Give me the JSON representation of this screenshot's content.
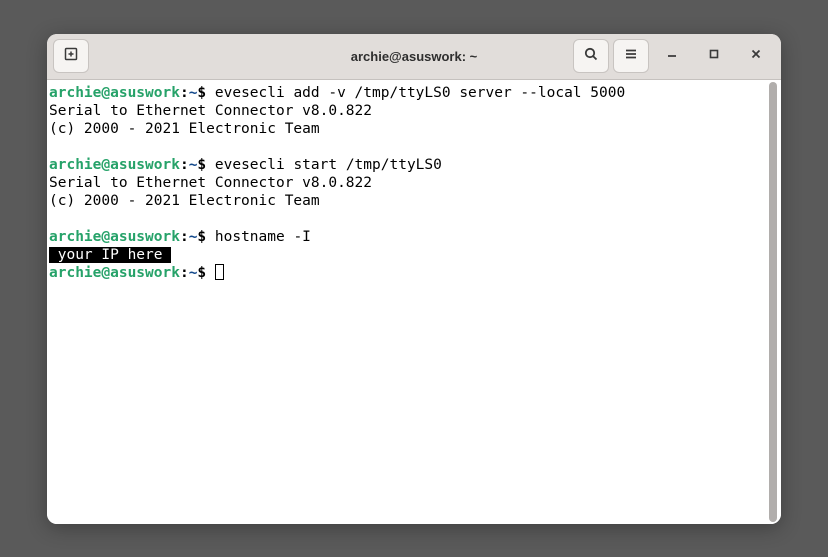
{
  "titlebar": {
    "title": "archie@asuswork: ~"
  },
  "prompt": {
    "user": "archie@asuswork",
    "sep": ":",
    "path": "~",
    "symbol": "$"
  },
  "terminal": {
    "cmd1": " evesecli add -v /tmp/ttyLS0 server --local 5000",
    "out1a": "Serial to Ethernet Connector v8.0.822",
    "out1b": "(c) 2000 - 2021 Electronic Team",
    "cmd2": " evesecli start /tmp/ttyLS0",
    "out2a": "Serial to Ethernet Connector v8.0.822",
    "out2b": "(c) 2000 - 2021 Electronic Team",
    "cmd3": " hostname -I",
    "out3": " your IP here ",
    "cmd4": " "
  },
  "icons": {
    "newtab": "new-tab-icon",
    "search": "search-icon",
    "menu": "menu-icon",
    "minimize": "minimize-icon",
    "maximize": "maximize-icon",
    "close": "close-icon"
  }
}
